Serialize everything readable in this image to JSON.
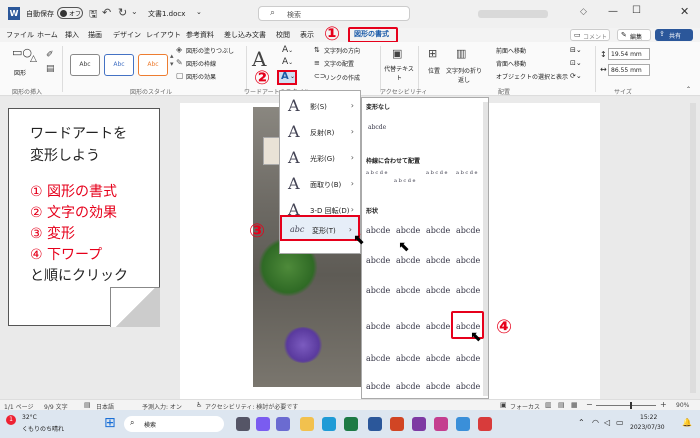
{
  "titlebar": {
    "autosave": "自動保存",
    "toggle": "オフ",
    "doc_name": "文書1.docx",
    "search_placeholder": "検索",
    "context_tab": "図形の書式"
  },
  "menu": [
    "ファイル",
    "ホーム",
    "挿入",
    "描画",
    "デザイン",
    "レイアウト",
    "参考資料",
    "差し込み文書",
    "校閲",
    "表示"
  ],
  "menu_right": {
    "comment": "コメント",
    "edit": "編集",
    "share": "共有"
  },
  "ribbon": {
    "insert_shapes_label": "図形",
    "groups": [
      "図形の挿入",
      "図形のスタイル",
      "ワードアートのスタイル",
      "アクセシビリティ",
      "配置",
      "サイズ"
    ],
    "style_sample": "Abc",
    "shape_fill": "図形の塗りつぶし",
    "shape_outline": "図形の枠線",
    "shape_effect": "図形の効果",
    "text_direction": "文字列の方向",
    "text_align": "文字の配置",
    "link": "リンクの作成",
    "alt_text": "代替テキスト",
    "position": "位置",
    "wrap": "文字列の折り返し",
    "forward": "前面へ移動",
    "backward": "背面へ移動",
    "select_pane": "オブジェクトの選択と表示",
    "height": "19.54 mm",
    "width": "86.55 mm"
  },
  "note": {
    "line1": "ワードアートを",
    "line2": "変形しよう",
    "steps": [
      "① 図形の書式",
      "② 文字の効果",
      "③ 変形",
      "④ 下ワープ"
    ],
    "last": "と順にクリック"
  },
  "text_effects_menu": [
    {
      "icon": "A",
      "label": "影(S)"
    },
    {
      "icon": "A",
      "label": "反射(R)"
    },
    {
      "icon": "A",
      "label": "光彩(G)"
    },
    {
      "icon": "A",
      "label": "面取り(B)"
    },
    {
      "icon": "A",
      "label": "3-D 回転(D)"
    },
    {
      "icon": "abc",
      "label": "変形(T)"
    }
  ],
  "transform": {
    "no_transform": "変形なし",
    "no_sample": "abcde",
    "follow_path": "枠線に合わせて配置",
    "warp": "形状",
    "sample": "abcde",
    "path_sample": "a b c d e"
  },
  "callouts": {
    "c1": "①",
    "c2": "②",
    "c3": "③",
    "c4": "④"
  },
  "status": {
    "page": "1/1 ページ",
    "words": "9/9 文字",
    "lang": "日本語",
    "predict": "予測入力: オン",
    "access": "アクセシビリティ: 検討が必要です",
    "focus": "フォーカス",
    "zoom": "90%"
  },
  "taskbar": {
    "temp": "32°C",
    "weather": "くもりのち晴れ",
    "search": "検索",
    "time": "15:22",
    "date": "2023/07/30",
    "badge": "1"
  }
}
